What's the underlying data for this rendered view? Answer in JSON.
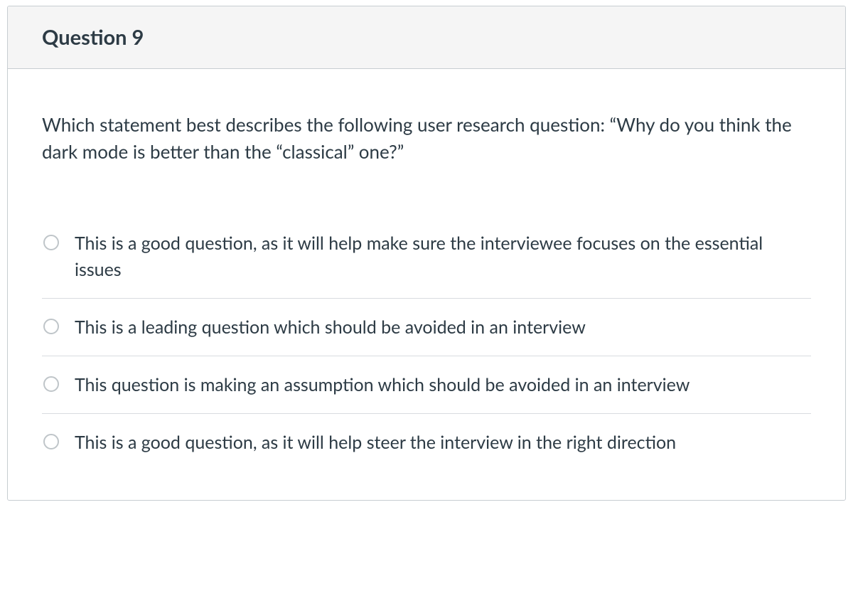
{
  "header": {
    "title": "Question 9"
  },
  "question": {
    "prompt": "Which statement best describes the following user research question: “Why do you think the dark mode is better than the “classical” one?”"
  },
  "options": [
    {
      "text": "This is a good question, as it will help make sure the interviewee focuses on the essential issues"
    },
    {
      "text": "This is a leading question which should be avoided in an interview"
    },
    {
      "text": "This question is making an assumption which should be avoided in an interview"
    },
    {
      "text": "This is a good question, as it will help steer the interview in the right direction"
    }
  ]
}
